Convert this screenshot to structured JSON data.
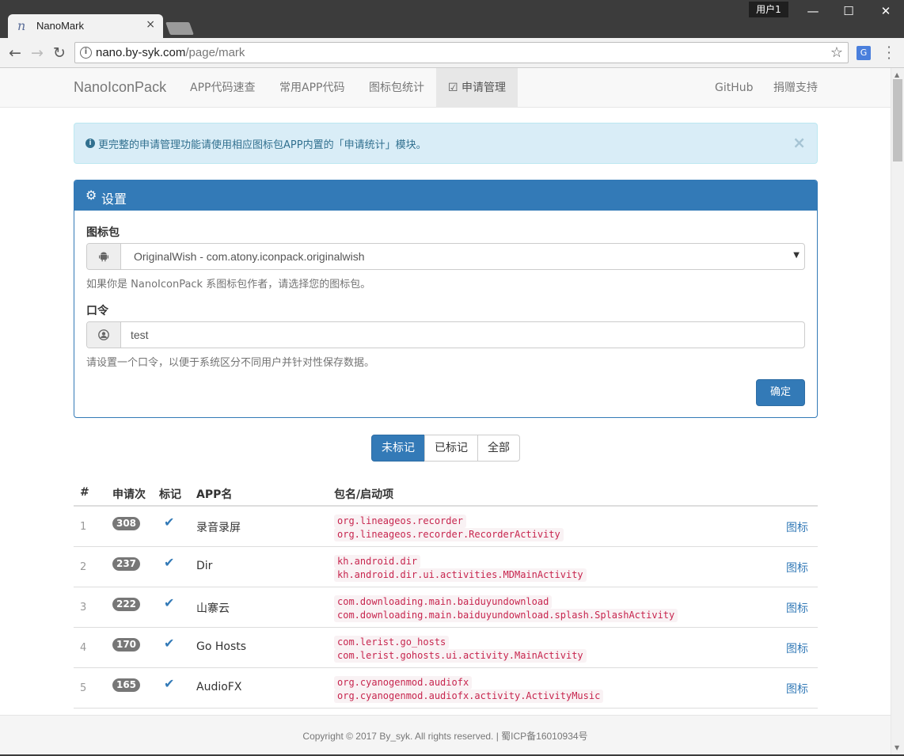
{
  "browser": {
    "tab_title": "NanoMark",
    "tab_icon_glyph": "n",
    "user_badge": "用户1",
    "url_host": "nano.by-syk.com",
    "url_path": "/page/mark"
  },
  "nav": {
    "brand": "NanoIconPack",
    "links": [
      "APP代码速查",
      "常用APP代码",
      "图标包统计",
      "申请管理"
    ],
    "right_links": [
      "GitHub",
      "捐赠支持"
    ]
  },
  "alert": {
    "text": "更完整的申请管理功能请使用相应图标包APP内置的「申请统计」模块。"
  },
  "settings": {
    "title": "设置",
    "iconpack_label": "图标包",
    "iconpack_value": "OriginalWish - com.atony.iconpack.originalwish",
    "iconpack_help": "如果你是 NanoIconPack 系图标包作者，请选择您的图标包。",
    "token_label": "口令",
    "token_value": "test",
    "token_help": "请设置一个口令，以便于系统区分不同用户并针对性保存数据。",
    "confirm_label": "确定"
  },
  "filter": {
    "options": [
      "未标记",
      "已标记",
      "全部"
    ],
    "selected": "未标记"
  },
  "table": {
    "headers": [
      "#",
      "申请次",
      "标记",
      "APP名",
      "包名/启动项"
    ],
    "rows": [
      {
        "index": "1",
        "count": "308",
        "name": "录音录屏",
        "pkg": "org.lineageos.recorder",
        "launcher": "org.lineageos.recorder.RecorderActivity",
        "link": "图标"
      },
      {
        "index": "2",
        "count": "237",
        "name": "Dir",
        "pkg": "kh.android.dir",
        "launcher": "kh.android.dir.ui.activities.MDMainActivity",
        "link": "图标"
      },
      {
        "index": "3",
        "count": "222",
        "name": "山寨云",
        "pkg": "com.downloading.main.baiduyundownload",
        "launcher": "com.downloading.main.baiduyundownload.splash.SplashActivity",
        "link": "图标"
      },
      {
        "index": "4",
        "count": "170",
        "name": "Go Hosts",
        "pkg": "com.lerist.go_hosts",
        "launcher": "com.lerist.gohosts.ui.activity.MainActivity",
        "link": "图标"
      },
      {
        "index": "5",
        "count": "165",
        "name": "AudioFX",
        "pkg": "org.cyanogenmod.audiofx",
        "launcher": "org.cyanogenmod.audiofx.activity.ActivityMusic",
        "link": "图标"
      }
    ]
  },
  "footer": {
    "text": "Copyright © 2017 By_syk. All rights reserved. | 蜀ICP备16010934号"
  },
  "colors": {
    "primary": "#337ab7",
    "alert_bg": "#d9edf7",
    "code_fg": "#c7254e",
    "code_bg": "#f9f2f4"
  }
}
